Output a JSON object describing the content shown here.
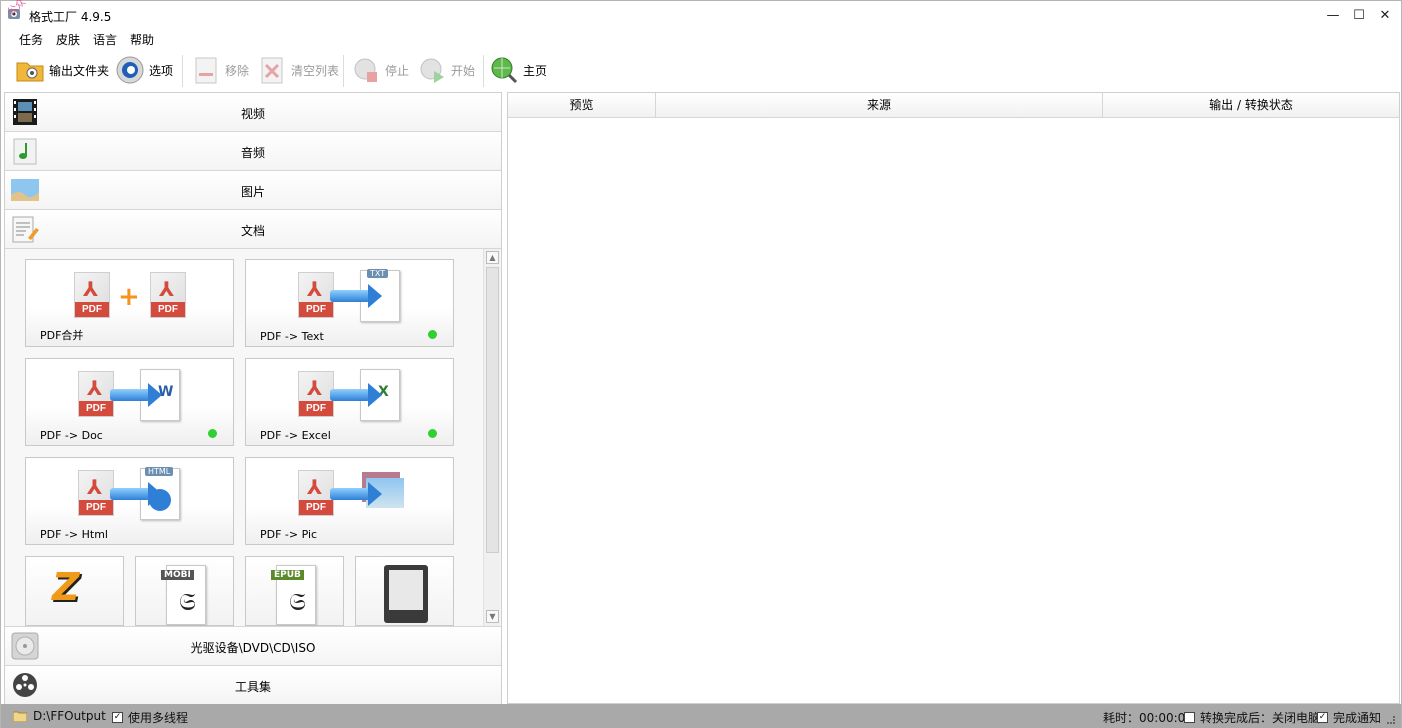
{
  "window": {
    "title": "格式工厂 4.9.5",
    "watermark": "公众号：软件分享",
    "minimize_glyph": "—",
    "maximize_glyph": "☐",
    "close_glyph": "✕"
  },
  "menu": {
    "items": [
      "任务",
      "皮肤",
      "语言",
      "帮助"
    ]
  },
  "toolbar": {
    "output_folder": "输出文件夹",
    "options": "选项",
    "remove": "移除",
    "clear_list": "清空列表",
    "stop": "停止",
    "start": "开始",
    "home": "主页"
  },
  "categories": {
    "video": "视频",
    "audio": "音频",
    "picture": "图片",
    "document": "文档",
    "disc": "光驱设备\\DVD\\CD\\ISO",
    "tools": "工具集"
  },
  "doc_tiles": [
    {
      "label": "PDF合并",
      "status_dot": false
    },
    {
      "label": "PDF -> Text",
      "status_dot": true,
      "target_badge": "TXT"
    },
    {
      "label": "PDF -> Doc",
      "status_dot": true,
      "target_badge": "W"
    },
    {
      "label": "PDF -> Excel",
      "status_dot": true,
      "target_badge": "X"
    },
    {
      "label": "PDF -> Html",
      "status_dot": false,
      "target_badge": "HTML"
    },
    {
      "label": "PDF -> Pic",
      "status_dot": false
    }
  ],
  "small_tiles": [
    {
      "icon": "zip-icon",
      "badge": "Z"
    },
    {
      "icon": "mobi-icon",
      "badge": "MOBI"
    },
    {
      "icon": "epub-icon",
      "badge": "EPUB"
    },
    {
      "icon": "ebook-reader-icon",
      "badge": ""
    }
  ],
  "pdf_badge": "PDF",
  "table": {
    "columns": [
      "预览",
      "来源",
      "输出 / 转换状态"
    ]
  },
  "status": {
    "output_path": "D:\\FFOutput",
    "multithread_label": "使用多线程",
    "multithread_checked": true,
    "elapsed": "耗时：00:00:00",
    "after_convert_label": "转换完成后：关闭电脑",
    "after_convert_checked": false,
    "notify_label": "完成通知",
    "notify_checked": true
  },
  "colors": {
    "status_bar": "#a9a9a9",
    "pdf_red": "#d44a3c",
    "dot_green": "#2fd02f",
    "arrow_blue": "#2f7fd6"
  }
}
